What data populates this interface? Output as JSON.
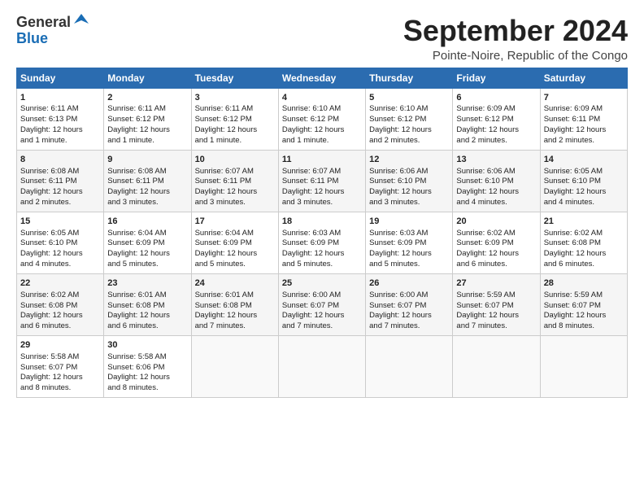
{
  "logo": {
    "general": "General",
    "blue": "Blue"
  },
  "title": "September 2024",
  "subtitle": "Pointe-Noire, Republic of the Congo",
  "days_of_week": [
    "Sunday",
    "Monday",
    "Tuesday",
    "Wednesday",
    "Thursday",
    "Friday",
    "Saturday"
  ],
  "weeks": [
    [
      {
        "day": "1",
        "sunrise": "6:11 AM",
        "sunset": "6:13 PM",
        "daylight": "12 hours and 1 minute."
      },
      {
        "day": "2",
        "sunrise": "6:11 AM",
        "sunset": "6:12 PM",
        "daylight": "12 hours and 1 minute."
      },
      {
        "day": "3",
        "sunrise": "6:11 AM",
        "sunset": "6:12 PM",
        "daylight": "12 hours and 1 minute."
      },
      {
        "day": "4",
        "sunrise": "6:10 AM",
        "sunset": "6:12 PM",
        "daylight": "12 hours and 1 minute."
      },
      {
        "day": "5",
        "sunrise": "6:10 AM",
        "sunset": "6:12 PM",
        "daylight": "12 hours and 2 minutes."
      },
      {
        "day": "6",
        "sunrise": "6:09 AM",
        "sunset": "6:12 PM",
        "daylight": "12 hours and 2 minutes."
      },
      {
        "day": "7",
        "sunrise": "6:09 AM",
        "sunset": "6:11 PM",
        "daylight": "12 hours and 2 minutes."
      }
    ],
    [
      {
        "day": "8",
        "sunrise": "6:08 AM",
        "sunset": "6:11 PM",
        "daylight": "12 hours and 2 minutes."
      },
      {
        "day": "9",
        "sunrise": "6:08 AM",
        "sunset": "6:11 PM",
        "daylight": "12 hours and 3 minutes."
      },
      {
        "day": "10",
        "sunrise": "6:07 AM",
        "sunset": "6:11 PM",
        "daylight": "12 hours and 3 minutes."
      },
      {
        "day": "11",
        "sunrise": "6:07 AM",
        "sunset": "6:11 PM",
        "daylight": "12 hours and 3 minutes."
      },
      {
        "day": "12",
        "sunrise": "6:06 AM",
        "sunset": "6:10 PM",
        "daylight": "12 hours and 3 minutes."
      },
      {
        "day": "13",
        "sunrise": "6:06 AM",
        "sunset": "6:10 PM",
        "daylight": "12 hours and 4 minutes."
      },
      {
        "day": "14",
        "sunrise": "6:05 AM",
        "sunset": "6:10 PM",
        "daylight": "12 hours and 4 minutes."
      }
    ],
    [
      {
        "day": "15",
        "sunrise": "6:05 AM",
        "sunset": "6:10 PM",
        "daylight": "12 hours and 4 minutes."
      },
      {
        "day": "16",
        "sunrise": "6:04 AM",
        "sunset": "6:09 PM",
        "daylight": "12 hours and 5 minutes."
      },
      {
        "day": "17",
        "sunrise": "6:04 AM",
        "sunset": "6:09 PM",
        "daylight": "12 hours and 5 minutes."
      },
      {
        "day": "18",
        "sunrise": "6:03 AM",
        "sunset": "6:09 PM",
        "daylight": "12 hours and 5 minutes."
      },
      {
        "day": "19",
        "sunrise": "6:03 AM",
        "sunset": "6:09 PM",
        "daylight": "12 hours and 5 minutes."
      },
      {
        "day": "20",
        "sunrise": "6:02 AM",
        "sunset": "6:09 PM",
        "daylight": "12 hours and 6 minutes."
      },
      {
        "day": "21",
        "sunrise": "6:02 AM",
        "sunset": "6:08 PM",
        "daylight": "12 hours and 6 minutes."
      }
    ],
    [
      {
        "day": "22",
        "sunrise": "6:02 AM",
        "sunset": "6:08 PM",
        "daylight": "12 hours and 6 minutes."
      },
      {
        "day": "23",
        "sunrise": "6:01 AM",
        "sunset": "6:08 PM",
        "daylight": "12 hours and 6 minutes."
      },
      {
        "day": "24",
        "sunrise": "6:01 AM",
        "sunset": "6:08 PM",
        "daylight": "12 hours and 7 minutes."
      },
      {
        "day": "25",
        "sunrise": "6:00 AM",
        "sunset": "6:07 PM",
        "daylight": "12 hours and 7 minutes."
      },
      {
        "day": "26",
        "sunrise": "6:00 AM",
        "sunset": "6:07 PM",
        "daylight": "12 hours and 7 minutes."
      },
      {
        "day": "27",
        "sunrise": "5:59 AM",
        "sunset": "6:07 PM",
        "daylight": "12 hours and 7 minutes."
      },
      {
        "day": "28",
        "sunrise": "5:59 AM",
        "sunset": "6:07 PM",
        "daylight": "12 hours and 8 minutes."
      }
    ],
    [
      {
        "day": "29",
        "sunrise": "5:58 AM",
        "sunset": "6:07 PM",
        "daylight": "12 hours and 8 minutes."
      },
      {
        "day": "30",
        "sunrise": "5:58 AM",
        "sunset": "6:06 PM",
        "daylight": "12 hours and 8 minutes."
      },
      null,
      null,
      null,
      null,
      null
    ]
  ],
  "labels": {
    "sunrise": "Sunrise: ",
    "sunset": "Sunset: ",
    "daylight": "Daylight: 12 hours"
  }
}
